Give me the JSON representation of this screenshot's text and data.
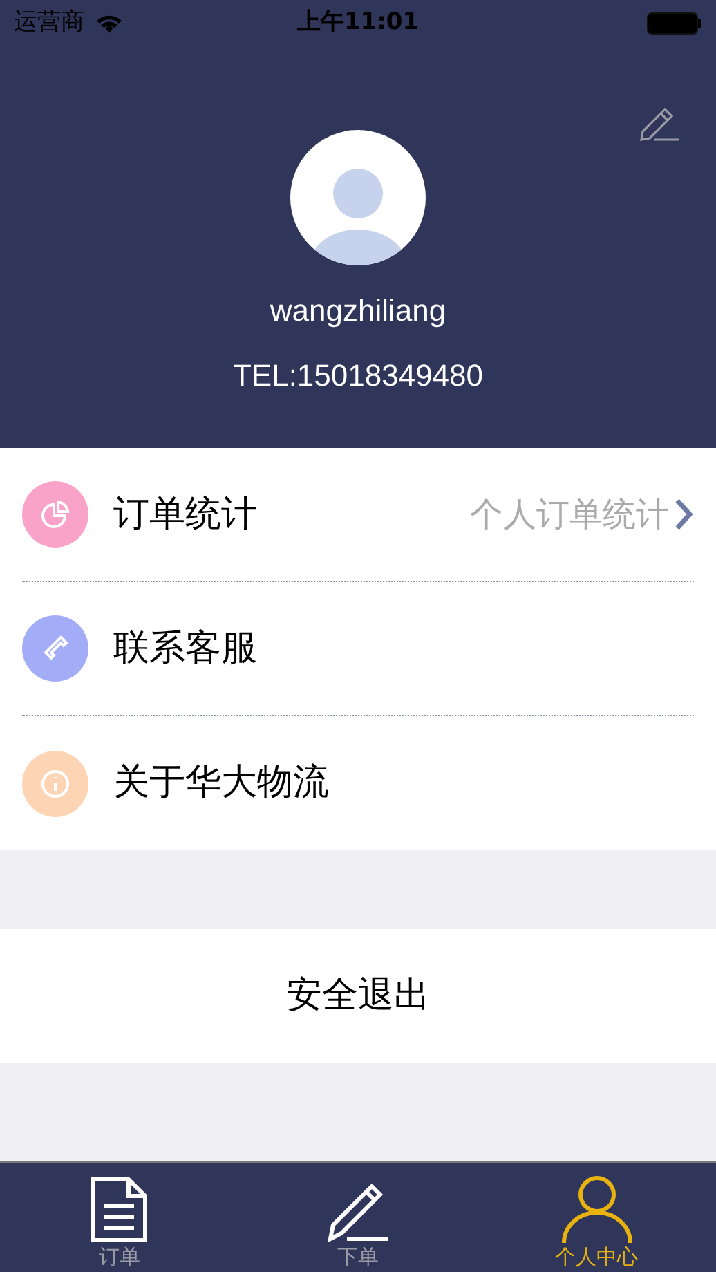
{
  "status_bar": {
    "carrier": "运营商",
    "time": "上午11:01"
  },
  "profile": {
    "username": "wangzhiliang",
    "phone": "TEL:15018349480"
  },
  "menu": [
    {
      "kind": "chart",
      "color": "#f9a3c8",
      "label": "订单统计",
      "detail": "个人订单统计"
    },
    {
      "kind": "phone",
      "color": "#a3acf6",
      "label": "联系客服"
    },
    {
      "kind": "info",
      "color": "#fdd5b5",
      "label": "关于华大物流"
    }
  ],
  "logout": "安全退出",
  "tabs": [
    {
      "kind": "document",
      "label": "订单",
      "selected": false
    },
    {
      "kind": "pencil",
      "label": "下单",
      "selected": false
    },
    {
      "kind": "person",
      "label": "个人中心",
      "selected": true
    }
  ]
}
